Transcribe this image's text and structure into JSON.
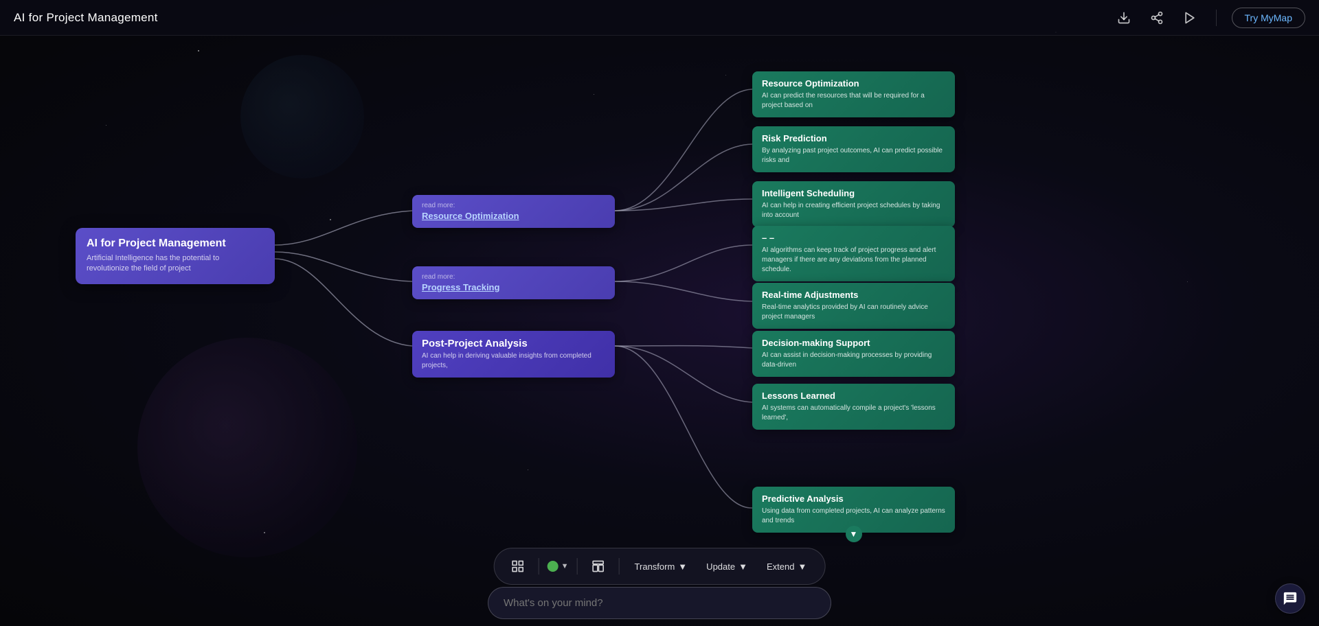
{
  "header": {
    "title": "AI for Project Management",
    "try_label": "Try MyMap"
  },
  "central_node": {
    "title": "AI for Project Management",
    "description": "Artificial Intelligence has the potential to revolutionize the field of project"
  },
  "branch_nodes": [
    {
      "id": "resource-opt",
      "read_more": "read more:",
      "title": "Resource Optimization",
      "description": ""
    },
    {
      "id": "progress-track",
      "read_more": "read more:",
      "title": "Progress Tracking",
      "description": ""
    },
    {
      "id": "post-project",
      "read_more": "",
      "title": "Post-Project Analysis",
      "description": "AI can help in deriving valuable insights from completed projects,"
    }
  ],
  "leaf_nodes": [
    {
      "id": "resource-opt-leaf",
      "title": "Resource Optimization",
      "description": "AI can predict the resources that will be required for a project based on"
    },
    {
      "id": "risk-prediction",
      "title": "Risk Prediction",
      "description": "By analyzing past project outcomes, AI can predict possible risks and"
    },
    {
      "id": "intelligent-scheduling",
      "title": "Intelligent Scheduling",
      "description": "AI can help in creating efficient project schedules by taking into account"
    },
    {
      "id": "progress-tracking-leaf",
      "title": "– –",
      "description": "AI algorithms can keep track of project progress and alert managers if there are any deviations from the planned schedule."
    },
    {
      "id": "realtime-adjustments",
      "title": "Real-time Adjustments",
      "description": "Real-time analytics provided by AI can routinely advice project managers"
    },
    {
      "id": "decision-making",
      "title": "Decision-making Support",
      "description": "AI can assist in decision-making processes by providing data-driven"
    },
    {
      "id": "lessons-learned",
      "title": "Lessons Learned",
      "description": "AI systems can automatically compile a project's 'lessons learned',"
    },
    {
      "id": "predictive-analysis",
      "title": "Predictive Analysis",
      "description": "Using data from completed projects, AI can analyze patterns and trends"
    }
  ],
  "toolbar": {
    "color_label": "green",
    "transform_label": "Transform",
    "update_label": "Update",
    "extend_label": "Extend"
  },
  "chat_input": {
    "placeholder": "What's on your mind?"
  }
}
